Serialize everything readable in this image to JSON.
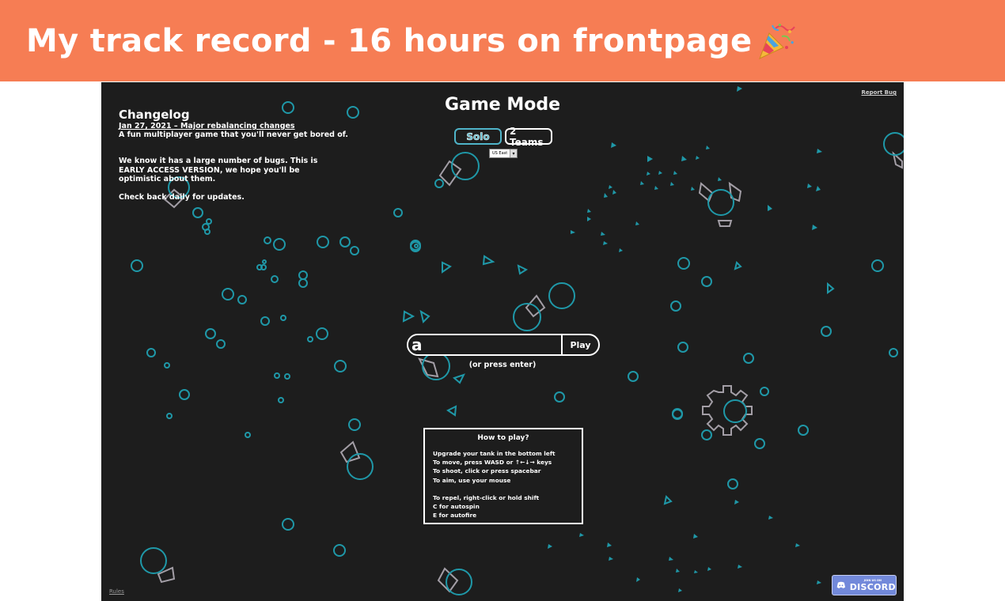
{
  "banner": {
    "title": "My track record - 16 hours on frontpage",
    "icon": "party-popper-icon"
  },
  "game": {
    "report_bug": "Report Bug",
    "changelog": {
      "title": "Changelog",
      "date_line": "Jan 27, 2021 – Major rebalancing changes",
      "tagline": "A fun multiplayer game that you'll never get bored of.",
      "notice": "We know it has a large number of bugs. This is EARLY ACCESS VERSION, we hope you'll be optimistic about them.",
      "check_back": "Check back daily for updates."
    },
    "mode": {
      "title": "Game Mode",
      "tabs": [
        {
          "label": "Solo",
          "selected": true
        },
        {
          "label": "2 Teams",
          "selected": false
        }
      ],
      "region": "US East"
    },
    "name_input": {
      "value": "a"
    },
    "play_label": "Play",
    "press_enter": "(or press enter)",
    "howto": {
      "title": "How to play?",
      "lines": [
        "Upgrade your tank in the bottom left",
        "To move, press WASD or ↑←↓→ keys",
        "To shoot, click or press spacebar",
        "To aim, use your mouse"
      ],
      "lines2": [
        "To repel, right-click or hold shift",
        "C for autospin",
        "E for autofire"
      ]
    },
    "rules": "Rules",
    "discord": {
      "join_text": "JOIN US ON",
      "label": "DISCORD"
    },
    "colors": {
      "banner": "#f67d54",
      "background": "#1d1d1d",
      "accent": "#2ab0c2",
      "tank_outline": "#a39ea6"
    }
  }
}
